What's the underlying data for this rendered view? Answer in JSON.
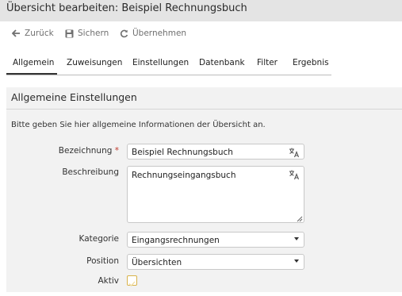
{
  "window": {
    "title": "Übersicht bearbeiten: Beispiel Rechnungsbuch"
  },
  "toolbar": {
    "back_label": "Zurück",
    "save_label": "Sichern",
    "apply_label": "Übernehmen"
  },
  "tabs": [
    {
      "label": "Allgemein",
      "active": true
    },
    {
      "label": "Zuweisungen",
      "active": false
    },
    {
      "label": "Einstellungen",
      "active": false
    },
    {
      "label": "Datenbank",
      "active": false
    },
    {
      "label": "Filter",
      "active": false
    },
    {
      "label": "Ergebnis",
      "active": false
    }
  ],
  "section": {
    "heading": "Allgemeine Einstellungen",
    "intro": "Bitte geben Sie hier allgemeine Informationen der Übersicht an."
  },
  "form": {
    "bezeichnung": {
      "label": "Bezeichnung",
      "required_mark": "*",
      "value": "Beispiel Rechnungsbuch"
    },
    "beschreibung": {
      "label": "Beschreibung",
      "value": "Rechnungseingangsbuch"
    },
    "kategorie": {
      "label": "Kategorie",
      "value": "Eingangsrechnungen"
    },
    "position": {
      "label": "Position",
      "value": "Übersichten"
    },
    "aktiv": {
      "label": "Aktiv",
      "checked": false
    }
  },
  "colors": {
    "title_bar_bg": "#e4e4e4",
    "panel_bg": "#f2f2f2",
    "required": "#c0392b",
    "checkbox_border": "#d8b24a"
  }
}
